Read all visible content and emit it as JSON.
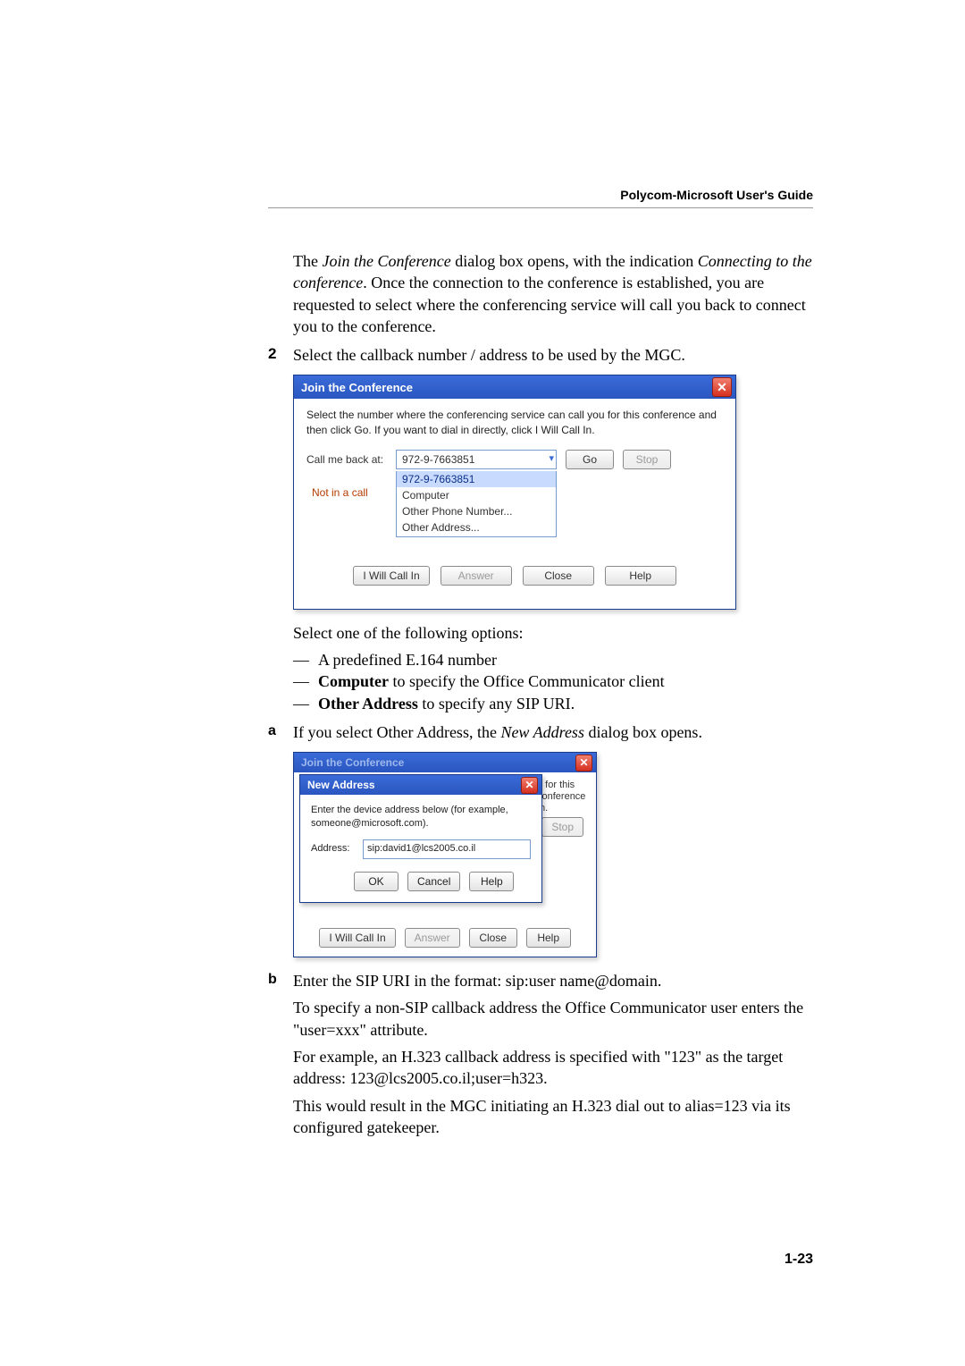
{
  "header": {
    "guide": "Polycom-Microsoft User's Guide"
  },
  "intro": {
    "pre": "The ",
    "em1": "Join the Conference",
    "mid1": " dialog box opens, with the indication ",
    "em2": "Connecting to the conference",
    "post": ". Once the connection to the conference is established, you are requested to select where the conferencing service will call you back to connect you to the conference."
  },
  "step2_num": "2",
  "step2_text": "Select the callback number / address to be used by the MGC.",
  "dlg1": {
    "title": "Join the Conference",
    "instr": "Select the number where the conferencing service can call you for this conference and then click Go. If you want to dial in directly, click I Will Call In.",
    "call_lbl": "Call me back at:",
    "selected": "972-9-7663851",
    "go": "Go",
    "stop": "Stop",
    "not_in_call": "Not in a call",
    "opts": [
      "972-9-7663851",
      "Computer",
      "Other Phone Number...",
      "Other Address..."
    ],
    "iwill": "I Will Call In",
    "answer": "Answer",
    "close": "Close",
    "help": "Help"
  },
  "after1": "Select one of the following options:",
  "bullets": {
    "b1": "A predefined E.164 number",
    "b2a": "Computer",
    "b2b": " to specify the Office Communicator client",
    "b3a": "Other Address",
    "b3b": " to specify any SIP URI."
  },
  "step_a_letter": "a",
  "step_a": {
    "pre": "If you select Other Address, the ",
    "em": "New Address",
    "post": " dialog box opens."
  },
  "dlg2": {
    "outer_title": "Join the Conference",
    "inner_title": "New Address",
    "instr": "Enter the device address below (for example, someone@microsoft.com).",
    "addr_lbl": "Address:",
    "addr_val": "sip:david1@lcs2005.co.il",
    "ok": "OK",
    "cancel": "Cancel",
    "help": "Help",
    "behind_text": "u for this conference In.",
    "stop": "Stop",
    "iwill": "I Will Call In",
    "answer": "Answer",
    "close": "Close",
    "help2": "Help"
  },
  "step_b_letter": "b",
  "step_b": {
    "l1": "Enter the SIP URI in the format: sip:user name@domain.",
    "l2": "To specify a non-SIP callback address the Office Communicator user enters the \"user=xxx\" attribute.",
    "l3": "For example, an H.323 callback address is specified with \"123\" as the target address: 123@lcs2005.co.il;user=h323.",
    "l4": "This would result in the MGC initiating an H.323 dial out to alias=123 via its configured gatekeeper."
  },
  "page_num": "1-23"
}
